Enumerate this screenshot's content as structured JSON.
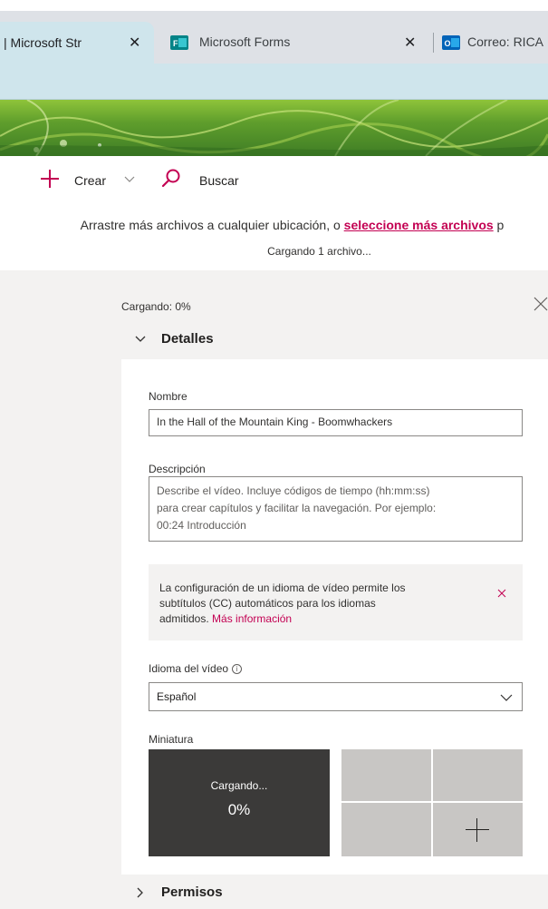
{
  "browser": {
    "tabs": [
      {
        "title": "| Microsoft Str",
        "close": "✕"
      },
      {
        "title": "Microsoft Forms",
        "close": "✕"
      },
      {
        "title": "Correo: RICA",
        "close": ""
      }
    ],
    "tab_colors": {
      "active": "#cfe5ec",
      "bar": "#dee1e6"
    }
  },
  "toolbar": {
    "create_label": "Crear",
    "search_label": "Buscar"
  },
  "upload": {
    "drop_hint_prefix": "Arrastre más archivos a cualquier ubicación, o ",
    "drop_hint_link": "seleccione más archivos",
    "drop_hint_suffix": " p",
    "uploading_count": "Cargando 1 archivo...",
    "progress_label": "Cargando: 0%"
  },
  "details": {
    "section_label": "Detalles",
    "name_label": "Nombre",
    "name_value": "In the Hall of the Mountain King - Boomwhackers",
    "description_label": "Descripción",
    "description_placeholder_1": "Describe el vídeo. Incluye códigos de tiempo (hh:mm:ss)",
    "description_placeholder_2": "para crear capítulos y facilitar la navegación. Por ejemplo:",
    "description_placeholder_3": "00:24 Introducción",
    "notice_line_1": "La configuración de un idioma de vídeo permite los",
    "notice_line_2": "subtítulos (CC) automáticos para los idiomas",
    "notice_line_3": "admitidos.",
    "notice_link": "Más información",
    "language_label": "Idioma del vídeo",
    "language_value": "Español",
    "thumbnail_label": "Miniatura",
    "thumbnail_loading": "Cargando...",
    "thumbnail_percent": "0%"
  },
  "permissions": {
    "section_label": "Permisos"
  },
  "colors": {
    "accent": "#c30052",
    "panel_grey": "#f3f2f1",
    "thumb_dark": "#3b3a39",
    "thumb_light": "#c8c6c4"
  },
  "icons": [
    "close-icon",
    "plus-icon",
    "chevron-down-icon",
    "search-icon",
    "chevron-right-icon",
    "info-icon",
    "forms-app-icon",
    "outlook-app-icon"
  ]
}
